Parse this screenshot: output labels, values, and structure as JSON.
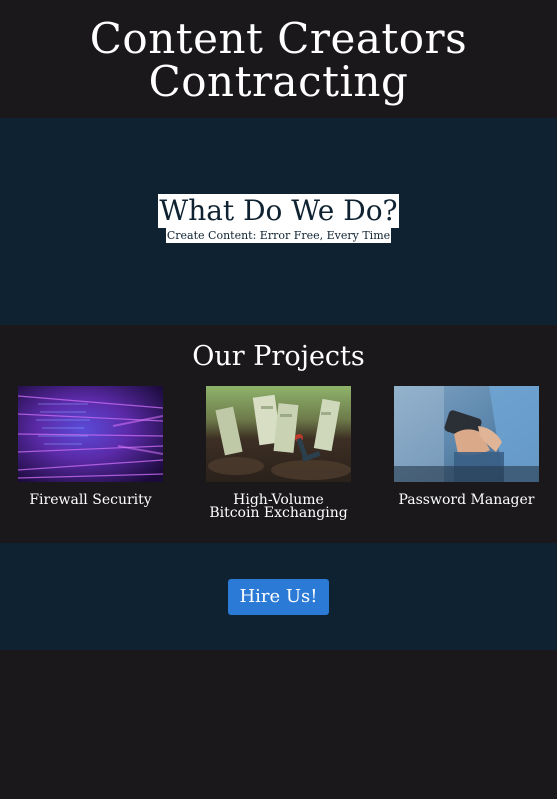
{
  "header": {
    "title": "Content Creators Contracting"
  },
  "hero": {
    "title": "What Do We Do?",
    "subtitle": "Create Content: Error Free, Every Time"
  },
  "projects": {
    "heading": "Our Projects",
    "items": [
      {
        "label": "Firewall Security",
        "image": "abstract-purple-data-image"
      },
      {
        "label": "High-Volume Bitcoin Exchanging",
        "image": "money-plant-image"
      },
      {
        "label": "Password Manager",
        "image": "phone-hands-image"
      }
    ]
  },
  "cta": {
    "button_label": "Hire Us!"
  },
  "colors": {
    "background": "#1a181b",
    "section_blue": "#0e2231",
    "button": "#2a7ad6",
    "text": "#ffffff"
  }
}
